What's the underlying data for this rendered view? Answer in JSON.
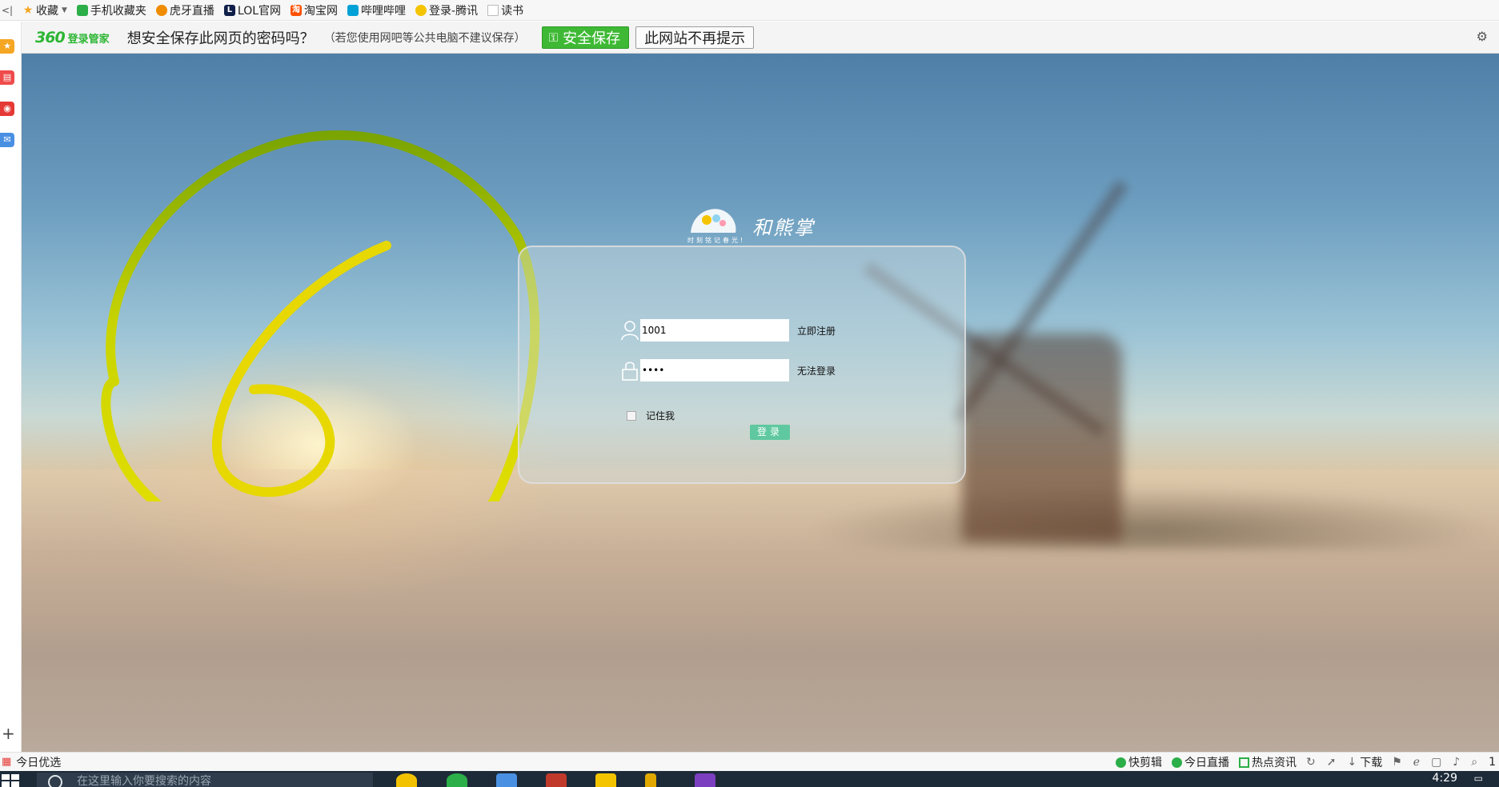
{
  "bookmarks": {
    "items": [
      {
        "label": "收藏",
        "icon": "star-icon",
        "color": "#f5a623"
      },
      {
        "label": "手机收藏夹",
        "icon": "phone-icon",
        "color": "#2cae48"
      },
      {
        "label": "虎牙直播",
        "icon": "huya-icon",
        "color": "#f08c00"
      },
      {
        "label": "LOL官网",
        "icon": "lol-icon",
        "color": "#10204a"
      },
      {
        "label": "淘宝网",
        "icon": "taobao-icon",
        "color": "#ff5000"
      },
      {
        "label": "哔哩哔哩",
        "icon": "bilibili-icon",
        "color": "#00a1d6"
      },
      {
        "label": "登录-腾讯",
        "icon": "qq-icon",
        "color": "#f5c400"
      },
      {
        "label": "读书",
        "icon": "document-icon",
        "color": "#bbbbbb"
      }
    ]
  },
  "password_bar": {
    "logo_num": "360",
    "logo_text": "登录管家",
    "question": "想安全保存此网页的密码吗？",
    "hint": "（若您使用网吧等公共电脑不建议保存）",
    "save_label": "安全保存",
    "never_label": "此网站不再提示"
  },
  "annotation": {
    "text": "6",
    "color": "#e8e000"
  },
  "brand": {
    "name": "和熊掌",
    "slogan": "时刻铭记春光!"
  },
  "login": {
    "username_value": "1001",
    "password_value": "••••",
    "register_link": "立即注册",
    "forgot_link": "无法登录",
    "remember_label": "记住我",
    "submit_label": "登录"
  },
  "status_bar": {
    "left_label": "今日优选",
    "items": [
      {
        "label": "快剪辑"
      },
      {
        "label": "今日直播"
      },
      {
        "label": "热点资讯"
      }
    ],
    "download_label": "下载",
    "zoom_label": "1"
  },
  "taskbar": {
    "search_placeholder": "在这里输入你要搜索的内容",
    "clock": "4:29"
  }
}
